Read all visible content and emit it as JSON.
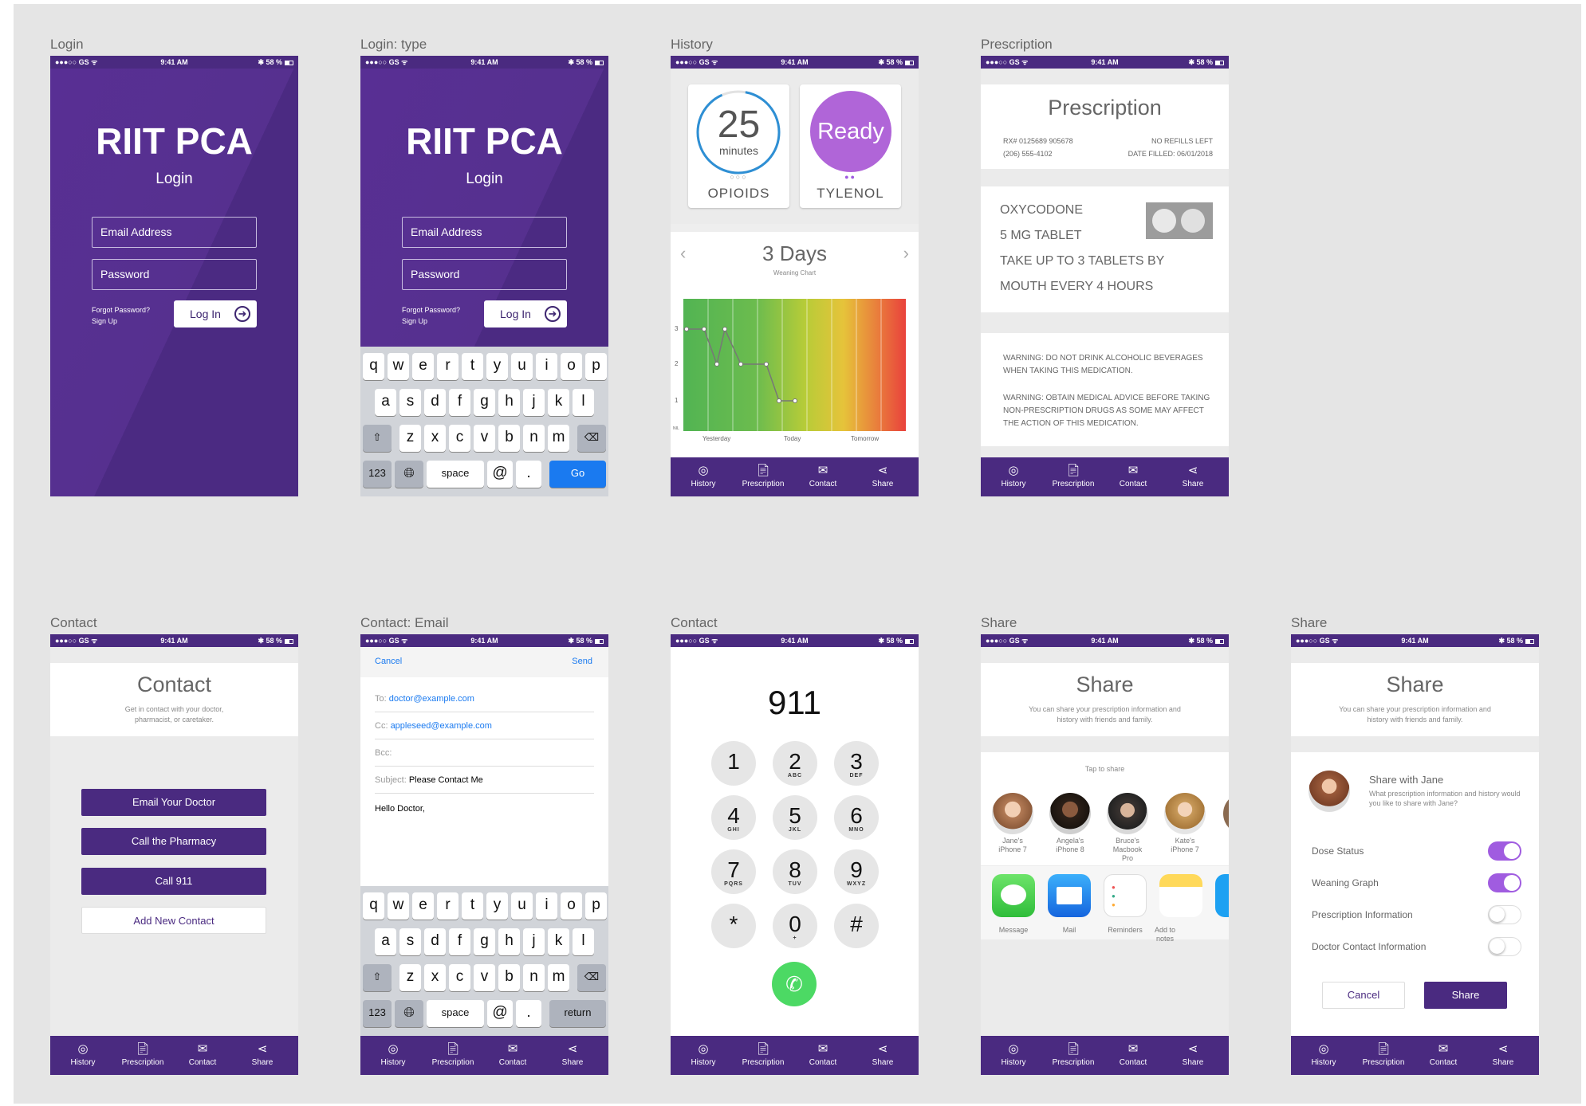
{
  "status": {
    "carrier": "●●●○○ GS ᯤ",
    "time": "9:41 AM",
    "battery": "✱ 58 %"
  },
  "tabs": [
    {
      "label": "History",
      "icon": "history-icon"
    },
    {
      "label": "Prescription",
      "icon": "prescription-icon"
    },
    {
      "label": "Contact",
      "icon": "mail-icon"
    },
    {
      "label": "Share",
      "icon": "share-icon"
    }
  ],
  "artboards": {
    "login": {
      "label": "Login",
      "title": "RIIT PCA",
      "subtitle": "Login",
      "email_placeholder": "Email Address",
      "password_placeholder": "Password",
      "forgot": "Forgot Password?",
      "signup": "Sign Up",
      "button": "Log In"
    },
    "login_type": {
      "label": "Login: type",
      "title": "RIIT PCA",
      "subtitle": "Login",
      "email_placeholder": "Email Address",
      "password_placeholder": "Password",
      "forgot": "Forgot Password?",
      "signup": "Sign Up",
      "button": "Log In"
    },
    "history": {
      "label": "History",
      "timer_value": "25",
      "timer_unit": "minutes",
      "card1_label": "OPIOIDS",
      "card2_value": "Ready",
      "card2_label": "TYLENOL",
      "days": "3 Days",
      "chart_caption": "Weaning Chart",
      "x_labels": [
        "Yesterday",
        "Today",
        "Tomorrow"
      ],
      "y_labels": [
        "3",
        "2",
        "1",
        "NIL"
      ]
    },
    "prescription": {
      "label": "Prescription",
      "title": "Prescription",
      "rx": "RX# 0125689 905678",
      "phone": "(206) 555-4102",
      "refills": "NO REFILLS LEFT",
      "filled": "DATE FILLED: 06/01/2018",
      "drug_lines": [
        "OXYCODONE",
        "5 MG TABLET",
        "TAKE UP TO 3 TABLETS BY",
        "MOUTH EVERY 4 HOURS"
      ],
      "warning1": "WARNING: DO NOT DRINK ALCOHOLIC BEVERAGES WHEN TAKING THIS MEDICATION.",
      "warning2": "WARNING: OBTAIN MEDICAL ADVICE BEFORE TAKING NON-PRESCRIPTION DRUGS AS SOME MAY AFFECT THE ACTION OF THIS MEDICATION."
    },
    "contact": {
      "label": "Contact",
      "title": "Contact",
      "subtitle": "Get in contact with your doctor, pharmacist, or caretaker.",
      "buttons": [
        "Email Your Doctor",
        "Call the Pharmacy",
        "Call 911",
        "Add New Contact"
      ]
    },
    "email": {
      "label": "Contact: Email",
      "cancel": "Cancel",
      "send": "Send",
      "to_label": "To:",
      "to": "doctor@example.com",
      "cc_label": "Cc:",
      "cc": "appleseed@example.com",
      "bcc_label": "Bcc:",
      "subject_label": "Subject:",
      "subject": "Please Contact Me",
      "body": "Hello Doctor,"
    },
    "dialer": {
      "label": "Contact",
      "number": "911",
      "keys": [
        {
          "n": "1",
          "s": ""
        },
        {
          "n": "2",
          "s": "ABC"
        },
        {
          "n": "3",
          "s": "DEF"
        },
        {
          "n": "4",
          "s": "GHI"
        },
        {
          "n": "5",
          "s": "JKL"
        },
        {
          "n": "6",
          "s": "MNO"
        },
        {
          "n": "7",
          "s": "PQRS"
        },
        {
          "n": "8",
          "s": "TUV"
        },
        {
          "n": "9",
          "s": "WXYZ"
        },
        {
          "n": "*",
          "s": ""
        },
        {
          "n": "0",
          "s": "+"
        },
        {
          "n": "#",
          "s": ""
        }
      ]
    },
    "share1": {
      "label": "Share",
      "title": "Share",
      "subtitle": "You can share your prescription information and history with friends and family.",
      "tap": "Tap to share",
      "people": [
        "Jane's iPhone 7",
        "Angela's iPhone 8",
        "Bruce's Macbook Pro",
        "Kate's iPhone 7"
      ],
      "apps": [
        "Message",
        "Mail",
        "Reminders",
        "Add to notes"
      ]
    },
    "share2": {
      "label": "Share",
      "title": "Share",
      "subtitle": "You can share your prescription information and history with friends and family.",
      "share_with": "Share with Jane",
      "share_q": "What prescription information and history would you like to share with Jane?",
      "options": [
        {
          "label": "Dose Status",
          "on": true
        },
        {
          "label": "Weaning Graph",
          "on": true
        },
        {
          "label": "Prescription Information",
          "on": false
        },
        {
          "label": "Doctor Contact Information",
          "on": false
        }
      ],
      "cancel": "Cancel",
      "share": "Share"
    }
  },
  "keyboard": {
    "row1": [
      "q",
      "w",
      "e",
      "r",
      "t",
      "y",
      "u",
      "i",
      "o",
      "p"
    ],
    "row2": [
      "a",
      "s",
      "d",
      "f",
      "g",
      "h",
      "j",
      "k",
      "l"
    ],
    "row3": [
      "z",
      "x",
      "c",
      "v",
      "b",
      "n",
      "m"
    ],
    "num": "123",
    "space": "space",
    "at": "@",
    "dot": ".",
    "go": "Go",
    "return": "return"
  },
  "colors": {
    "purple": "#4a2a80",
    "accent": "#a05ce0",
    "blue": "#1a7af0",
    "green": "#4cd964"
  }
}
